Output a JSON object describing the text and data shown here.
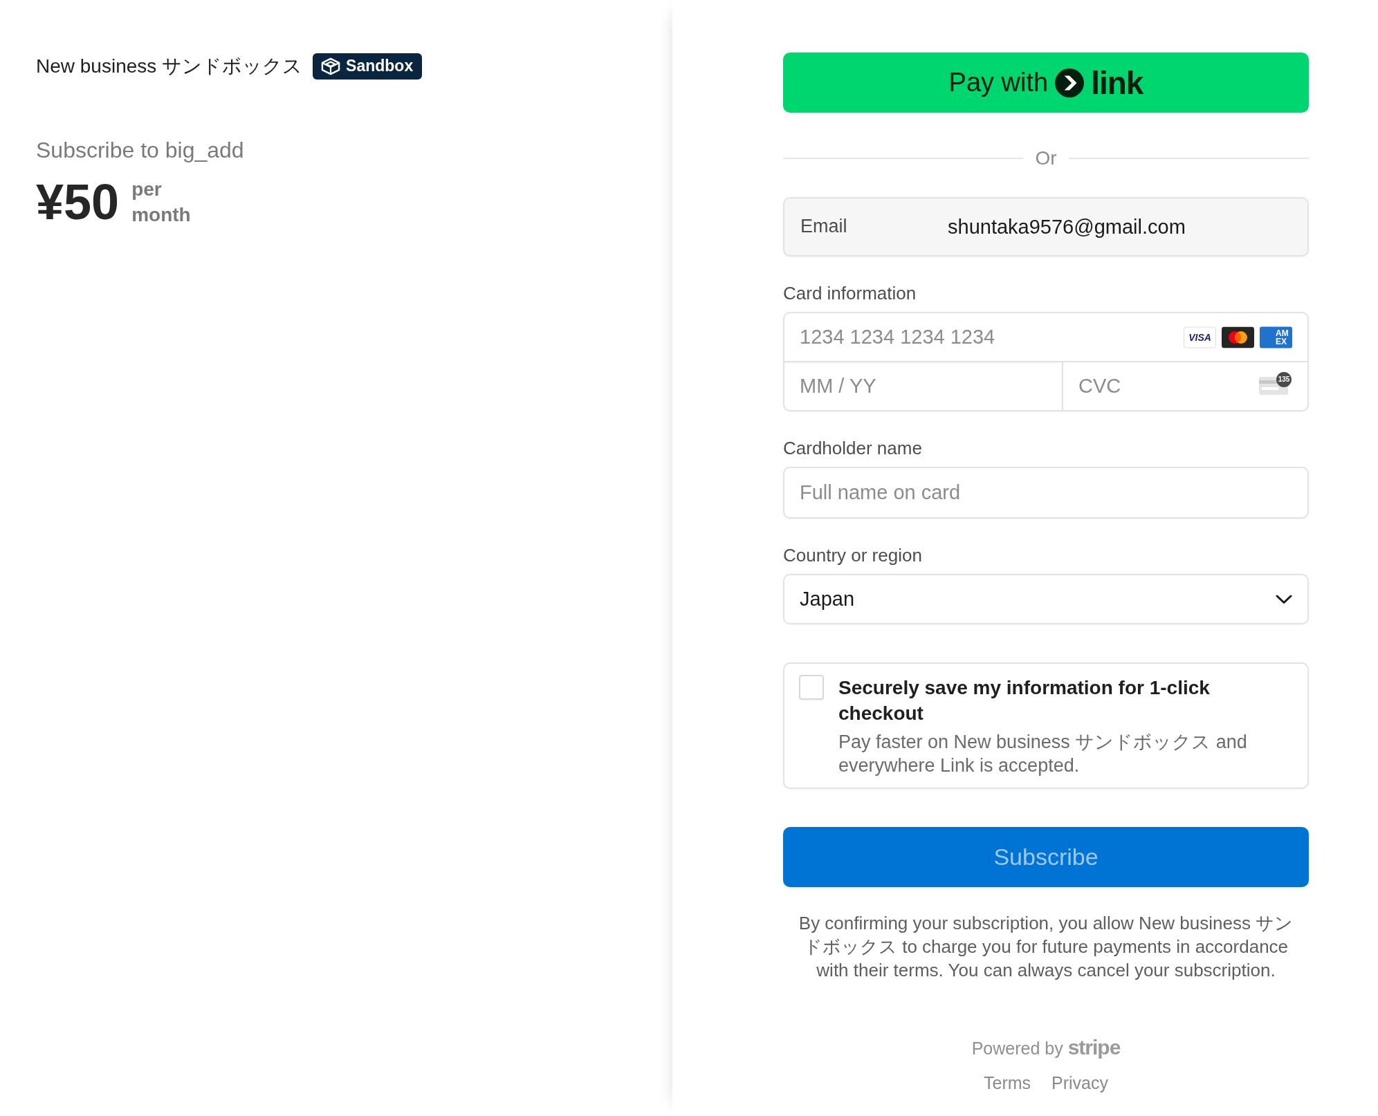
{
  "merchant": {
    "name": "New business サンドボックス",
    "badge": "Sandbox"
  },
  "product": {
    "title": "Subscribe to big_add",
    "price": "¥50",
    "period": "per month"
  },
  "link_button": {
    "text": "Pay with",
    "logo_text": "link"
  },
  "divider": {
    "text": "Or"
  },
  "email": {
    "label": "Email",
    "value": "shuntaka9576@gmail.com"
  },
  "card": {
    "label": "Card information",
    "number_placeholder": "1234 1234 1234 1234",
    "brands": [
      {
        "kind": "visa",
        "text": "VISA"
      },
      {
        "kind": "mastercard"
      },
      {
        "kind": "amex",
        "text": "AMEX"
      }
    ],
    "expiry_placeholder": "MM / YY",
    "cvc_placeholder": "CVC",
    "cvc_hint": "135"
  },
  "cardholder": {
    "label": "Cardholder name",
    "placeholder": "Full name on card"
  },
  "country": {
    "label": "Country or region",
    "value": "Japan"
  },
  "save_info": {
    "checked": false,
    "title": "Securely save my information for 1-click checkout",
    "description": "Pay faster on New business サンドボックス and everywhere Link is accepted."
  },
  "subscribe_button": {
    "text": "Subscribe",
    "disabled": true
  },
  "legal": "By confirming your subscription, you allow New business サンドボックス to charge you for future payments in accordance with their terms. You can always cancel your subscription.",
  "footer": {
    "powered_by": "Powered by **stripe**",
    "links": [
      "Terms",
      "Privacy"
    ]
  }
}
